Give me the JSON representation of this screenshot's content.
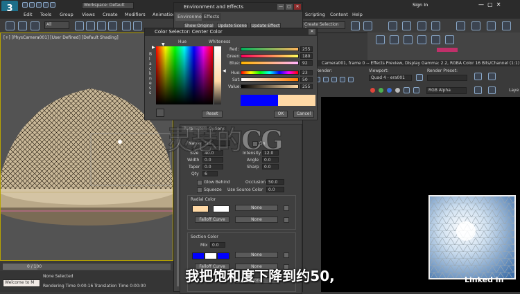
{
  "app": {
    "logo": "3",
    "workspace": "Workspace: Default",
    "signin": "Sign In",
    "menus": [
      "Edit",
      "Tools",
      "Group",
      "Views",
      "Create",
      "Modifiers",
      "Animation",
      "Scripting",
      "Content",
      "Help"
    ],
    "selection_set": "Create Selection Se",
    "filter": "All"
  },
  "viewport": {
    "label": "[+] [PhysCamera001] [User Defined] [Default Shading]",
    "timeline": "0 / 100"
  },
  "env_dialog": {
    "title": "Environment and Effects",
    "tabs": [
      "Environment",
      "Effects"
    ],
    "buttons": [
      "Show Original",
      "Update Scene",
      "Update Effect"
    ],
    "subtabs": [
      "Parameters",
      "Options"
    ],
    "fields": {
      "name_label": "Name",
      "name_value": "Sta",
      "on_label": "On",
      "size_label": "Size",
      "size_value": "40.0",
      "intensity_label": "Intensity",
      "intensity_value": "12.0",
      "width_label": "Width",
      "width_value": "0.0",
      "angle_label": "Angle",
      "angle_value": "0.0",
      "taper_label": "Taper",
      "taper_value": "0.0",
      "sharp_label": "Sharp",
      "sharp_value": "0.0",
      "qty_label": "Qty",
      "qty_value": "6",
      "glow_behind": "Glow Behind",
      "occlusion_label": "Occlusion",
      "occlusion_value": "50.0",
      "squeeze": "Squeeze",
      "use_source_color": "Use Source Color",
      "use_source_value": "0.0"
    },
    "radial": {
      "header": "Radial Color",
      "none1": "None",
      "none2": "None",
      "falloff": "Falloff Curve"
    },
    "section": {
      "header": "Section Color",
      "mix_label": "Mix",
      "mix_value": "0.0",
      "none1": "None",
      "none2": "None",
      "none3": "None",
      "falloff": "Falloff Curve"
    }
  },
  "color_selector": {
    "title": "Color Selector: Center Color",
    "hue_label": "Hue",
    "whiteness_label": "Whiteness",
    "blackness_label": "B l a c k n e s s",
    "channels": [
      {
        "name": "Red:",
        "value": "255"
      },
      {
        "name": "Green:",
        "value": "180"
      },
      {
        "name": "Blue:",
        "value": "92"
      },
      {
        "name": "Hue:",
        "value": "23"
      },
      {
        "name": "Sat:",
        "value": "50"
      },
      {
        "name": "Value:",
        "value": "255"
      }
    ],
    "reset": "Reset",
    "ok": "OK",
    "cancel": "Cancel",
    "old_color": "#0000ff",
    "new_color": "#ffd9a6"
  },
  "render_frame": {
    "title": "Camera001, frame 0 -- Effects Preview, Display Gamma: 2.2, RGBA Color 16 Bits/Channel (1:1)",
    "render_label": "Render:",
    "viewport_label": "Viewport:",
    "viewport_value": "Quad 4 - era001",
    "preset_label": "Render Preset:",
    "channel": "RGB Alpha",
    "layer": "Laye"
  },
  "status": {
    "field": "Welcome to M",
    "selection": "None Selected",
    "render_time": "Rendering Time 0:00:16",
    "translation_time": "Translation Time 0:00:00"
  },
  "overlay": {
    "subtitle": "我把饱和度下降到约50,",
    "watermark": "灵瑟的CG",
    "linkedin": "Linked in"
  }
}
